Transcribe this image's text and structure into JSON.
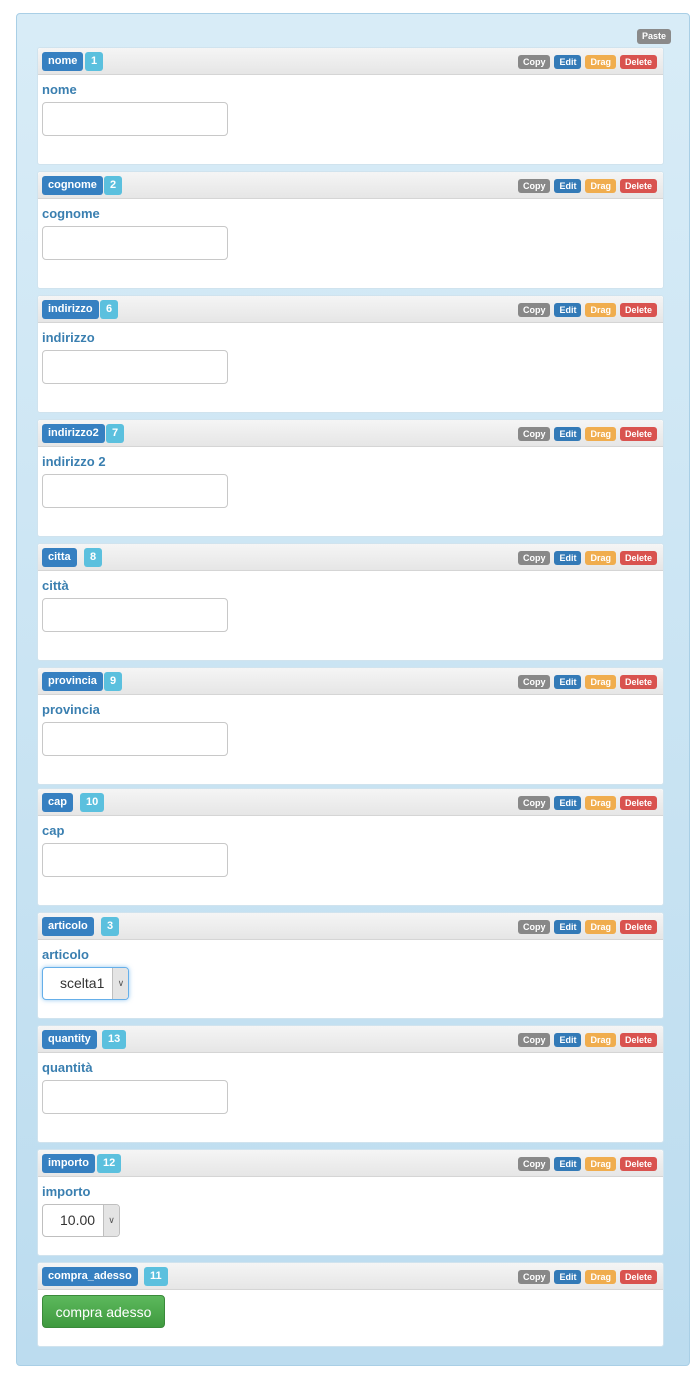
{
  "toolbar": {
    "paste_label": "Paste"
  },
  "actions": {
    "copy": "Copy",
    "edit": "Edit",
    "drag": "Drag",
    "delete": "Delete"
  },
  "fields": [
    {
      "name": "nome",
      "id": "1",
      "label": "nome",
      "type": "text",
      "value": ""
    },
    {
      "name": "cognome",
      "id": "2",
      "label": "cognome",
      "type": "text",
      "value": ""
    },
    {
      "name": "indirizzo",
      "id": "6",
      "label": "indirizzo",
      "type": "text",
      "value": ""
    },
    {
      "name": "indirizzo2",
      "id": "7",
      "label": "indirizzo 2",
      "type": "text",
      "value": ""
    },
    {
      "name": "citta",
      "id": "8",
      "label": "città",
      "type": "text",
      "value": ""
    },
    {
      "name": "provincia",
      "id": "9",
      "label": "provincia",
      "type": "text",
      "value": ""
    },
    {
      "name": "cap",
      "id": "10",
      "label": "cap",
      "type": "text",
      "value": ""
    },
    {
      "name": "articolo",
      "id": "3",
      "label": "articolo",
      "type": "select",
      "value": "scelta1"
    },
    {
      "name": "quantity",
      "id": "13",
      "label": "quantità",
      "type": "text",
      "value": ""
    },
    {
      "name": "importo",
      "id": "12",
      "label": "importo",
      "type": "select",
      "value": "10.00"
    },
    {
      "name": "compra_adesso",
      "id": "11",
      "label": "compra adesso",
      "type": "button"
    }
  ]
}
